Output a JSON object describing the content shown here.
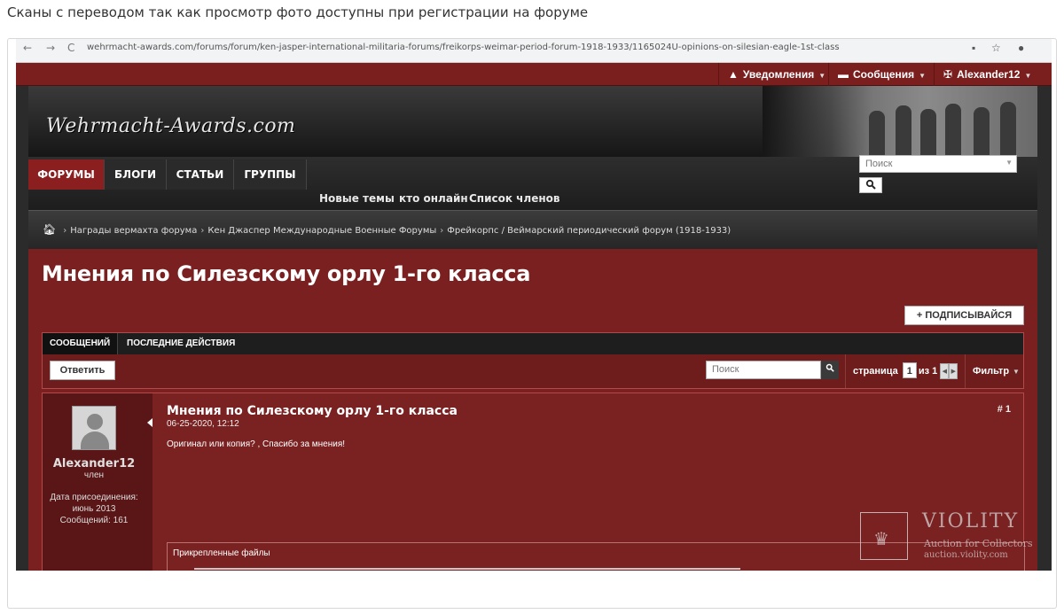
{
  "caption": "Сканы с переводом так как просмотр фото доступны при регистрации на форуме",
  "browser": {
    "url": "wehrmacht-awards.com/forums/forum/ken-jasper-international-militaria-forums/freikorps-weimar-period-forum-1918-1933/1165024U-opinions-on-silesian-eagle-1st-class",
    "back": "←",
    "forward": "→",
    "reload": "C"
  },
  "userbar": {
    "notifications": "Уведомления",
    "messages": "Сообщения",
    "username": "Alexander12"
  },
  "logo": "Wehrmacht-Awards.com",
  "nav": {
    "tabs": [
      "ФОРУМЫ",
      "БЛОГИ",
      "СТАТЬИ",
      "ГРУППЫ"
    ],
    "subnav": [
      "Новые темы",
      "кто онлайн",
      "Список членов"
    ],
    "search_placeholder": "Поиск"
  },
  "breadcrumbs": [
    "Награды вермахта форума",
    "Кен Джаспер Международные Военные Форумы",
    "Фрейкорпс / Веймарский периодический форум (1918-1933)"
  ],
  "thread": {
    "title": "Мнения по Силезскому орлу 1-го класса",
    "subscribe": "ПОДПИСЫВАЙСЯ",
    "tabs": [
      "СООБЩЕНИЙ",
      "ПОСЛЕДНИЕ ДЕЙСТВИЯ"
    ],
    "reply": "Ответить",
    "search_placeholder": "Поиск",
    "page_label": "страница",
    "page_current": "1",
    "page_of": "из 1",
    "filter": "Фильтр"
  },
  "post": {
    "username": "Alexander12",
    "role": "член",
    "join_label": "Дата присоединения:",
    "join_date": "июнь 2013",
    "posts_label": "Сообщений: 161",
    "title": "Мнения по Силезскому орлу 1-го класса",
    "date": "06-25-2020, 12:12",
    "number": "# 1",
    "text": "Оригинал или копия? , Спасибо за мнения!",
    "attachments_label": "Прикрепленные файлы"
  },
  "watermark": {
    "brand": "VIOLITY",
    "tagline": "Auction for Collectors",
    "site": "auction.violity.com"
  },
  "colors": {
    "forum_red": "#7a2020",
    "dark": "#1e1e1e",
    "active_tab": "#8b1e1e"
  }
}
